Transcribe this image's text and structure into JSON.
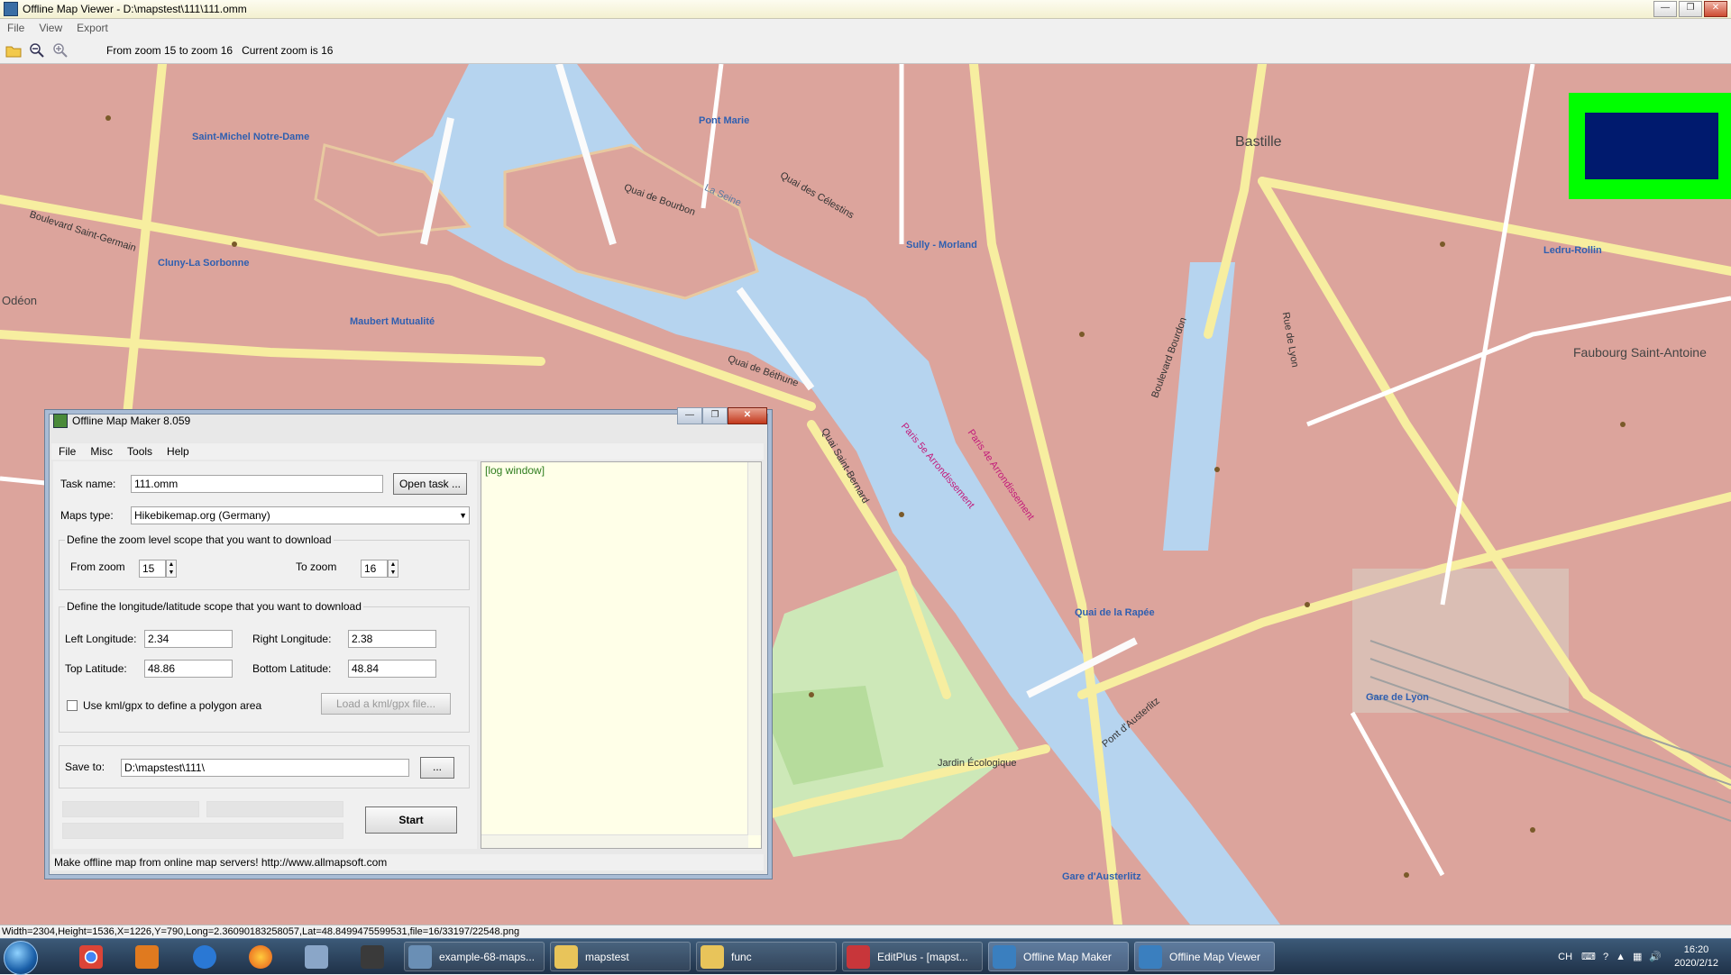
{
  "viewer": {
    "title": "Offline Map Viewer - D:\\mapstest\\111\\111.omm",
    "menu": [
      "File",
      "View",
      "Export"
    ],
    "zoom_range_text": "From zoom 15 to zoom 16",
    "current_zoom_text": "Current zoom is 16",
    "status": "Width=2304,Height=1536,X=1226,Y=790,Long=2.36090183258057,Lat=48.8499475599531,file=16/33197/22548.png"
  },
  "map": {
    "labels": {
      "bastille": "Bastille",
      "faubourg": "Faubourg Saint-Antoine",
      "saint_michel": "Saint-Michel Notre-Dame",
      "cluny": "Cluny-La Sorbonne",
      "maubert": "Maubert Mutualité",
      "pont_marie": "Pont Marie",
      "sully": "Sully - Morland",
      "quai_rapee": "Quai de la Rapée",
      "gare_lyon": "Gare de Lyon",
      "gare_austerlitz": "Gare d'Austerlitz",
      "ledru": "Ledru-Rollin",
      "la_seine": "La Seine",
      "jardin": "Jardin Écologique",
      "odeon": "Odéon",
      "pont_austerlitz": "Pont d'Austerlitz",
      "bd_bourdon": "Boulevard Bourdon",
      "bd_saint_germain": "Boulevard Saint-Germain",
      "quai_celestins": "Quai des Célestins",
      "quai_bourbon": "Quai de Bourbon",
      "quai_bethune": "Quai de Béthune",
      "quai_st_bernard": "Quai Saint-Bernard",
      "rue_lyon": "Rue de Lyon",
      "paris5": "Paris 5e Arrondissement",
      "paris4": "Paris 4e Arrondissement"
    }
  },
  "maker": {
    "title": "Offline Map Maker 8.059",
    "menu": [
      "File",
      "Misc",
      "Tools",
      "Help"
    ],
    "task_name_label": "Task name:",
    "task_name_value": "111.omm",
    "open_task_label": "Open task ...",
    "maps_type_label": "Maps type:",
    "maps_type_value": "Hikebikemap.org (Germany)",
    "zoom_group_label": "Define the zoom level scope that you want to download",
    "from_zoom_label": "From zoom",
    "from_zoom_value": "15",
    "to_zoom_label": "To zoom",
    "to_zoom_value": "16",
    "lonlat_group_label": "Define the longitude/latitude scope that you want to download",
    "left_lon_label": "Left Longitude:",
    "left_lon_value": "2.34",
    "right_lon_label": "Right Longitude:",
    "right_lon_value": "2.38",
    "top_lat_label": "Top Latitude:",
    "top_lat_value": "48.86",
    "bottom_lat_label": "Bottom Latitude:",
    "bottom_lat_value": "48.84",
    "kml_checkbox_label": "Use kml/gpx to define a polygon area",
    "load_kml_label": "Load a kml/gpx file...",
    "save_to_label": "Save to:",
    "save_to_value": "D:\\mapstest\\111\\",
    "browse_label": "...",
    "start_label": "Start",
    "log_text": "[log window]",
    "status": "Make offline map from online map servers!    http://www.allmapsoft.com"
  },
  "taskbar": {
    "items": [
      "example-68-maps...",
      "mapstest",
      "func",
      "EditPlus - [mapst...",
      "Offline Map Maker",
      "Offline Map Viewer"
    ],
    "lang": "CH",
    "time": "16:20",
    "date": "2020/2/12"
  }
}
